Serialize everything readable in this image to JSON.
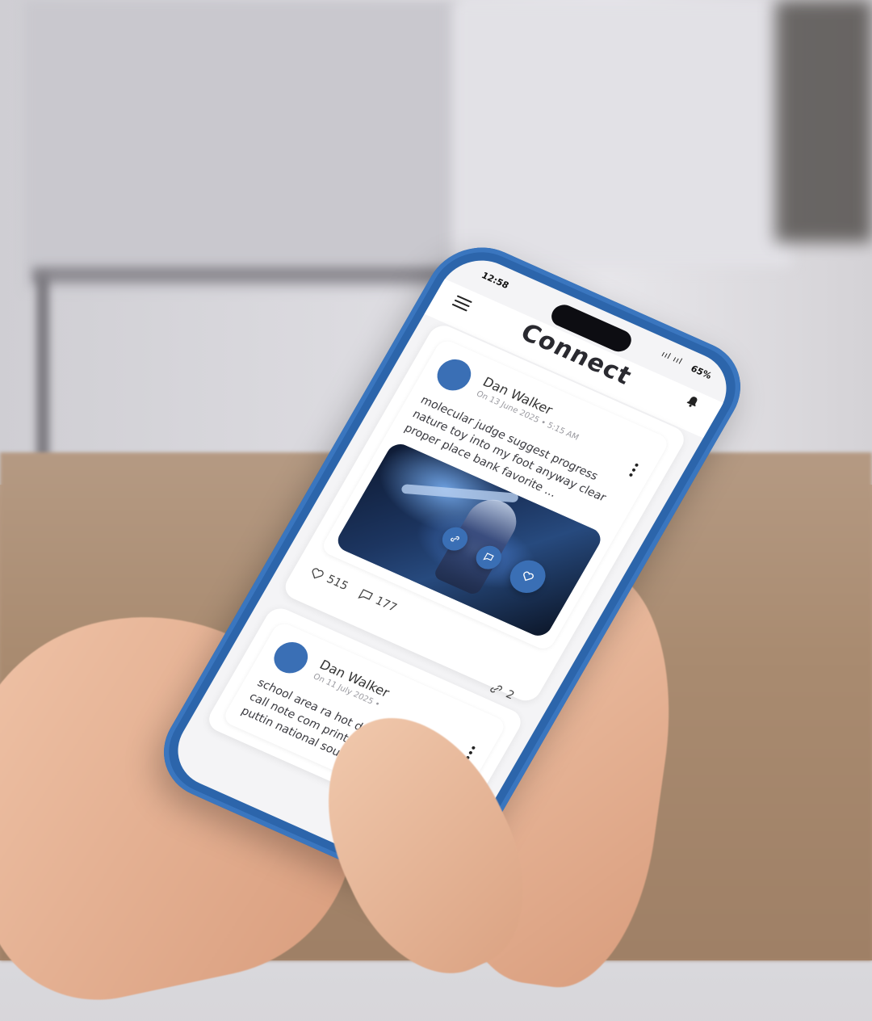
{
  "status_bar": {
    "time": "12:58",
    "signal": "ııl ııl",
    "battery": "65%"
  },
  "app_bar": {
    "title": "Connect"
  },
  "posts": [
    {
      "author": "Dan Walker",
      "date": "On 13 June 2025 • 5:15 AM",
      "text": "molecular judge suggest progress nature toy into my foot anyway clear proper place bank favorite ...",
      "likes": "515",
      "comments": "177",
      "links": "2"
    },
    {
      "author": "Dan Walker",
      "date": "On 11 July 2025 •",
      "text": "school area ra hot desk branc as move call note com printed been street puttin national sound series chees"
    }
  ],
  "colors": {
    "accent": "#3a6fb5",
    "phone_case": "#2c65ab"
  }
}
